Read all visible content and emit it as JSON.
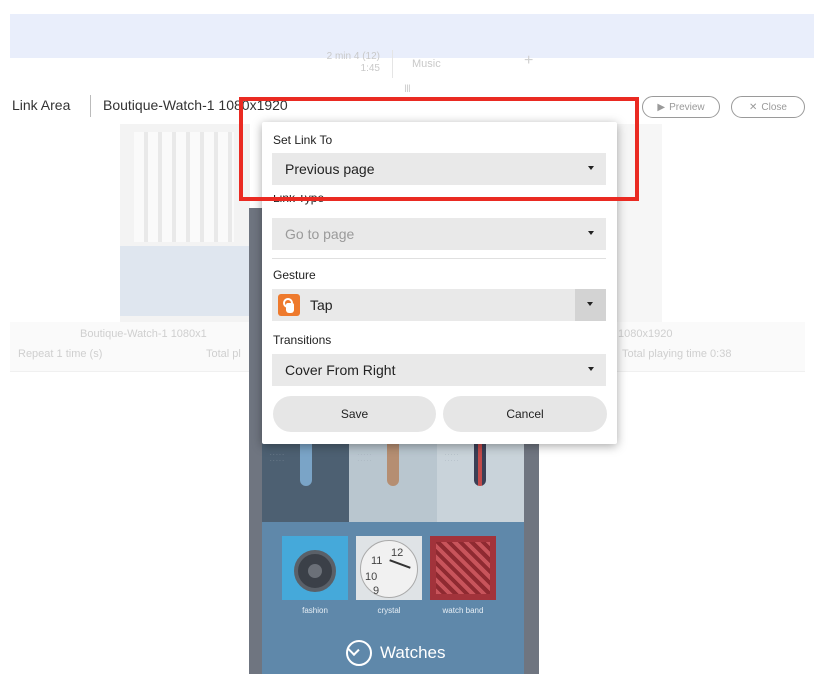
{
  "background": {
    "toolbar": {
      "time_line1": "2 min 4 (12)",
      "time_line2": "1:45",
      "music_label": "Music",
      "plus": "+",
      "spark": "Ⅲ"
    },
    "header": {
      "title": "Link Area",
      "project": "Boutique-Watch-1 1080x1920",
      "preview_label": "Preview",
      "close_label": "Close"
    },
    "labels": {
      "left_name": "Boutique-Watch-1 1080x1",
      "left_repeat": "Repeat 1 time (s)",
      "left_total": "Total pl",
      "right_name": "1080x1920",
      "right_total": "Total playing time 0:38"
    }
  },
  "phone": {
    "categories": [
      {
        "label": "fashion"
      },
      {
        "label": "crystal"
      },
      {
        "label": "watch band"
      }
    ],
    "section_title": "Watches"
  },
  "dialog": {
    "set_link_label": "Set Link To",
    "set_link_value": "Previous page",
    "link_type_label": "Link Type",
    "link_type_value": "Go to page",
    "gesture_label": "Gesture",
    "gesture_value": "Tap",
    "transitions_label": "Transitions",
    "transitions_value": "Cover From Right",
    "save_label": "Save",
    "cancel_label": "Cancel"
  },
  "colors": {
    "highlight": "#ea2a22",
    "tap_icon": "#ee7a2d",
    "band": "#e9eefb"
  },
  "icons": {
    "preview": "play-icon",
    "close": "close-icon",
    "gesture": "tap-hand-icon",
    "dropdown": "caret-down-icon",
    "watches": "clock-icon"
  }
}
